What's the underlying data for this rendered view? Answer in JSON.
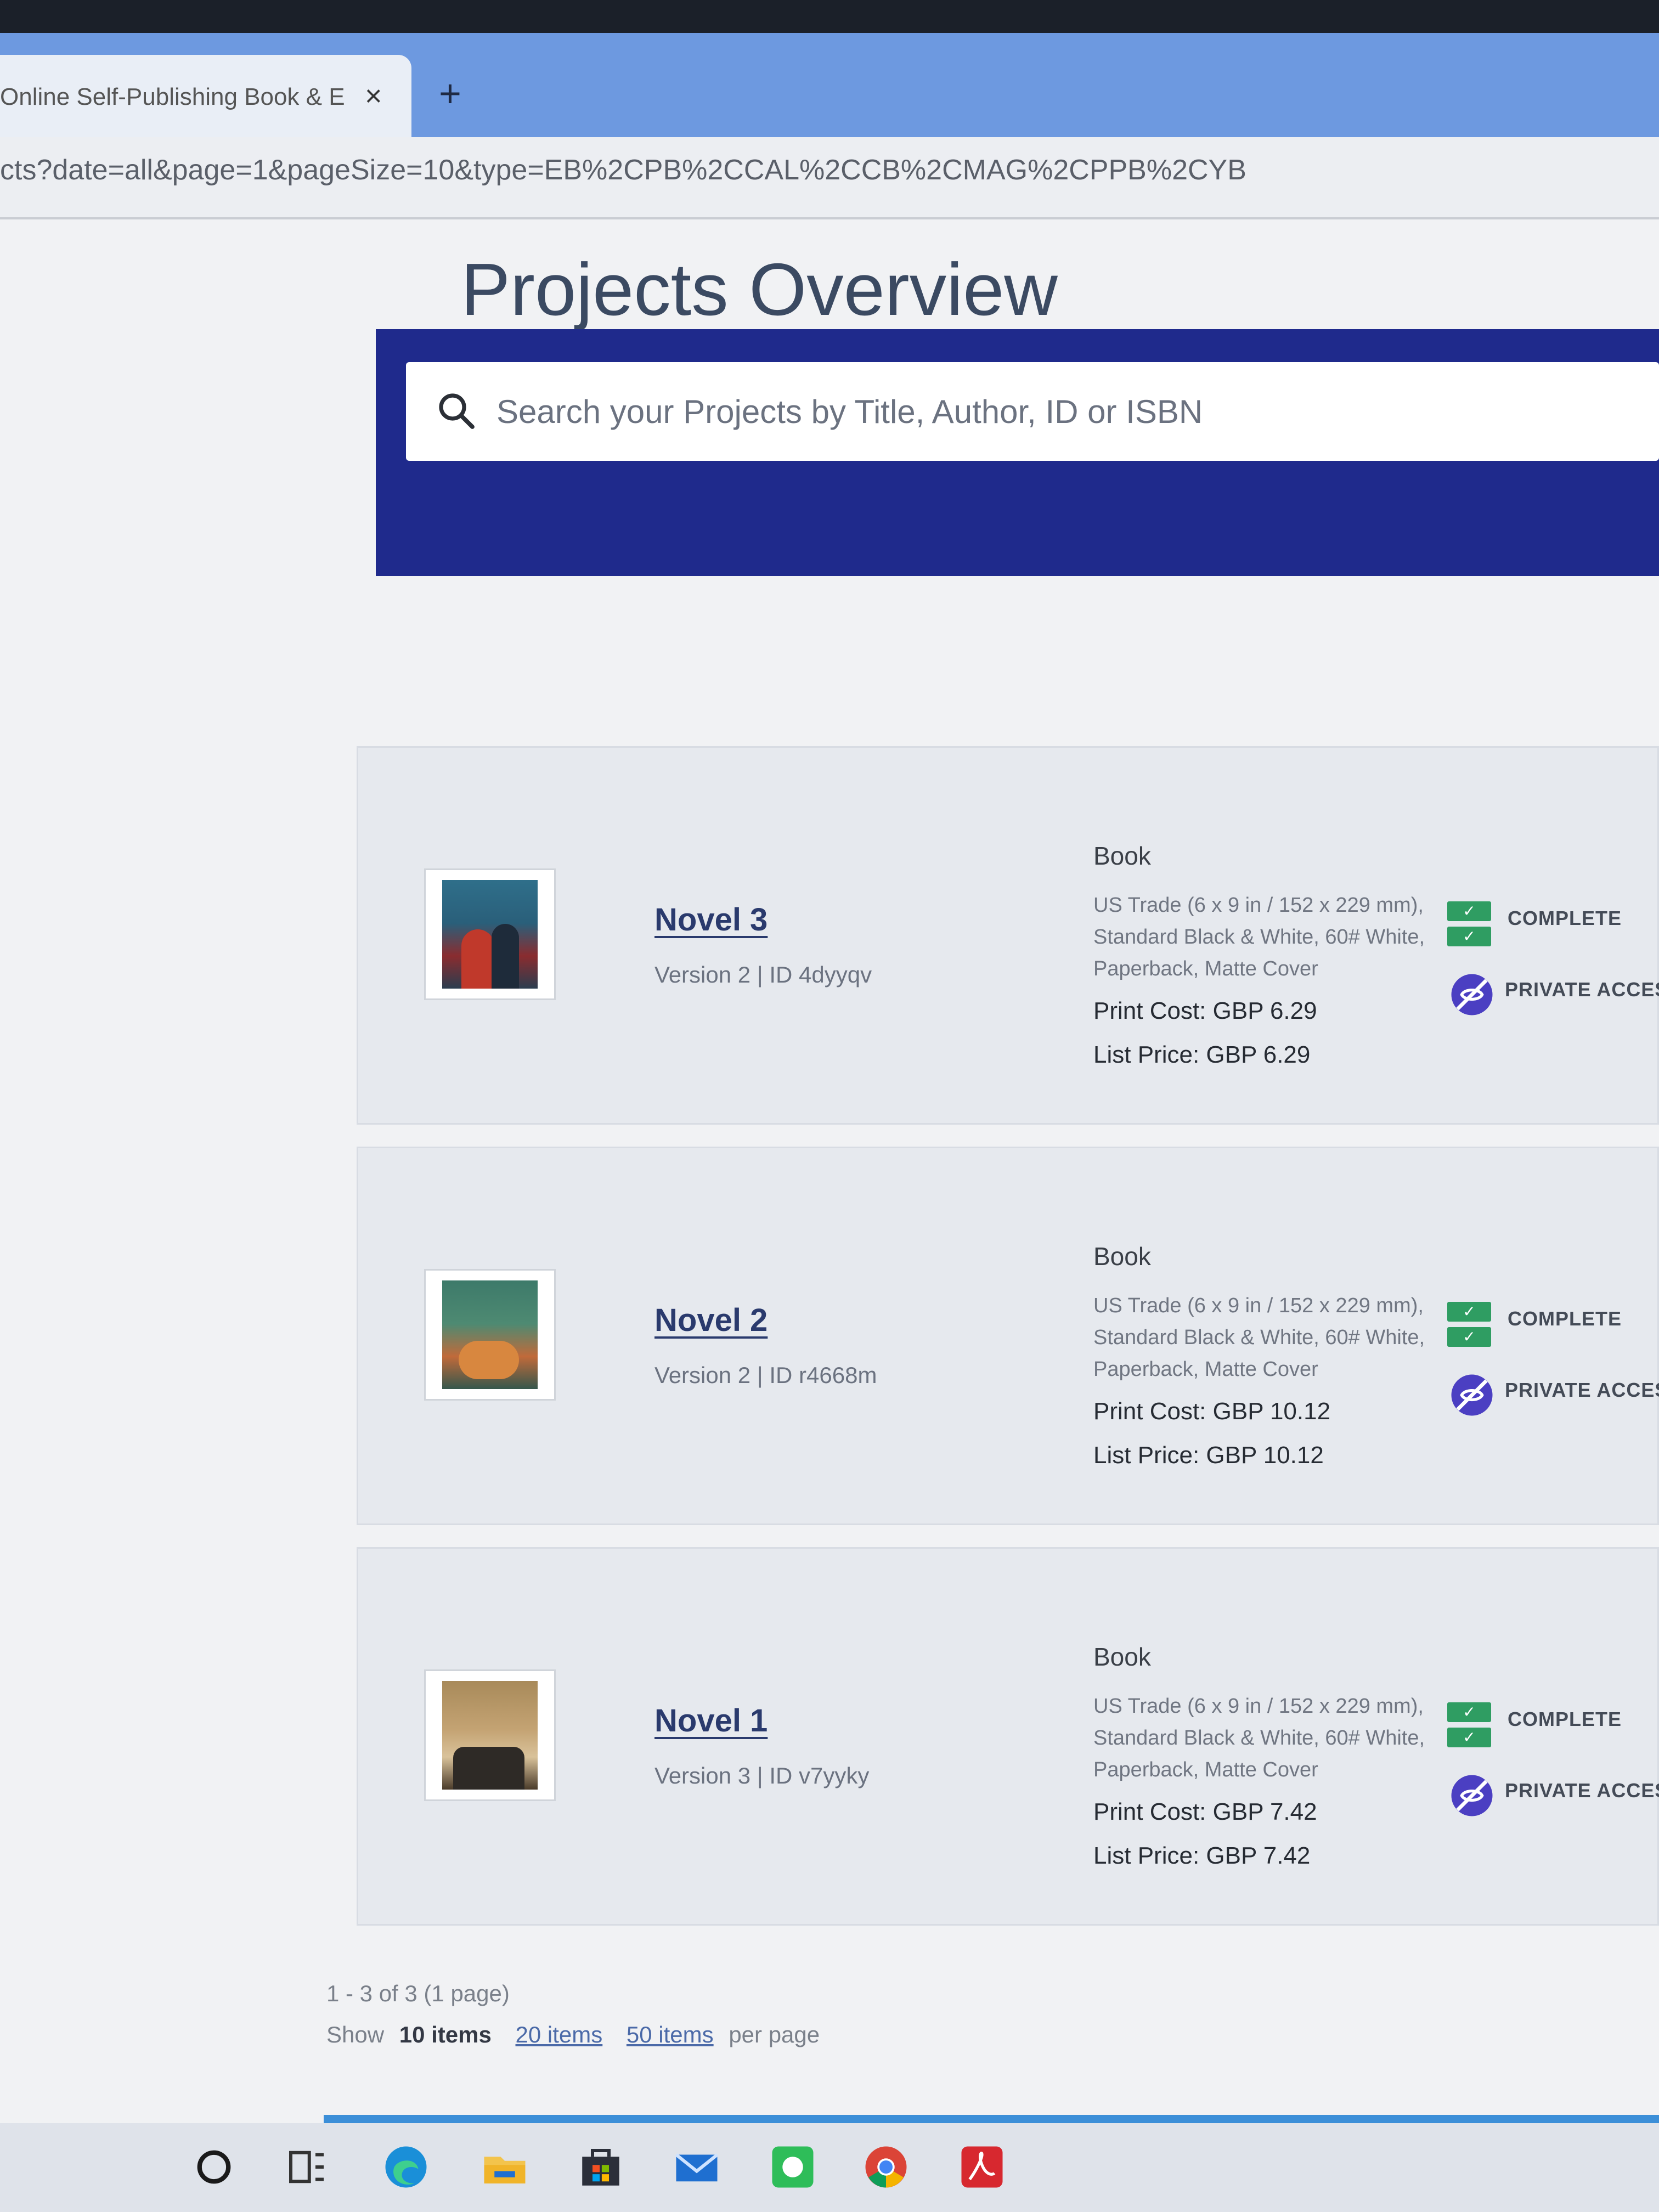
{
  "browser": {
    "tab_title": "Online Self-Publishing Book & E",
    "tab_close": "×",
    "new_tab": "+",
    "url": "cts?date=all&page=1&pageSize=10&type=EB%2CPB%2CCAL%2CCB%2CMAG%2CPPB%2CYB"
  },
  "page": {
    "title": "Projects Overview",
    "search_placeholder": "Search your Projects by Title, Author, ID or ISBN"
  },
  "projects": [
    {
      "name": "Novel 3",
      "meta": "Version 2 | ID 4dyyqv",
      "kind": "Book",
      "specs": "US Trade (6 x 9 in / 152 x 229 mm), Standard Black & White, 60# White, Paperback, Matte Cover",
      "print_cost": "Print Cost: GBP 6.29",
      "list_price": "List Price: GBP 6.29",
      "status": "COMPLETE",
      "access": "PRIVATE ACCESS"
    },
    {
      "name": "Novel 2",
      "meta": "Version 2 | ID r4668m",
      "kind": "Book",
      "specs": "US Trade (6 x 9 in / 152 x 229 mm), Standard Black & White, 60# White, Paperback, Matte Cover",
      "print_cost": "Print Cost: GBP 10.12",
      "list_price": "List Price: GBP 10.12",
      "status": "COMPLETE",
      "access": "PRIVATE ACCESS"
    },
    {
      "name": "Novel 1",
      "meta": "Version 3 | ID v7yyky",
      "kind": "Book",
      "specs": "US Trade (6 x 9 in / 152 x 229 mm), Standard Black & White, 60# White, Paperback, Matte Cover",
      "print_cost": "Print Cost: GBP 7.42",
      "list_price": "List Price: GBP 7.42",
      "status": "COMPLETE",
      "access": "PRIVATE ACCESS"
    }
  ],
  "pagination": {
    "summary": "1 - 3 of 3 (1 page)",
    "show_label": "Show",
    "current": "10 items",
    "option_20": "20 items",
    "option_50": "50 items",
    "per_page": "per page"
  },
  "colors": {
    "brand_navy": "#1f2a8c",
    "complete_green": "#2f9d62",
    "access_purple": "#4b3fc2"
  }
}
